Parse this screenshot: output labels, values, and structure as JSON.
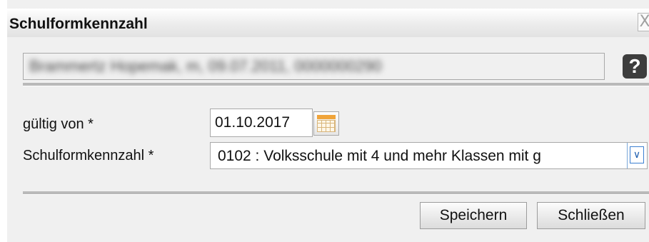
{
  "dialog": {
    "title": "Schulformkennzahl",
    "close_label": "X"
  },
  "info_field": {
    "value": "Brammertz Hopemak, m, 09.07.2011, 0000000290"
  },
  "help": {
    "label": "?"
  },
  "form": {
    "valid_from_label": "gültig von *",
    "valid_from_value": "01.10.2017",
    "school_code_label": "Schulformkennzahl *",
    "school_code_value": "0102 : Volksschule mit 4 und mehr Klassen mit g"
  },
  "buttons": {
    "save": "Speichern",
    "close": "Schließen"
  },
  "icons": {
    "calendar": "calendar-icon",
    "dropdown": "chevron-down-icon",
    "help": "question-icon",
    "close": "close-icon"
  },
  "colors": {
    "title_text": "#111111",
    "dialog_bg": "#f0f0f0",
    "select_arrow_border": "#3c7fd1",
    "calendar_accent": "#f0a43a"
  }
}
